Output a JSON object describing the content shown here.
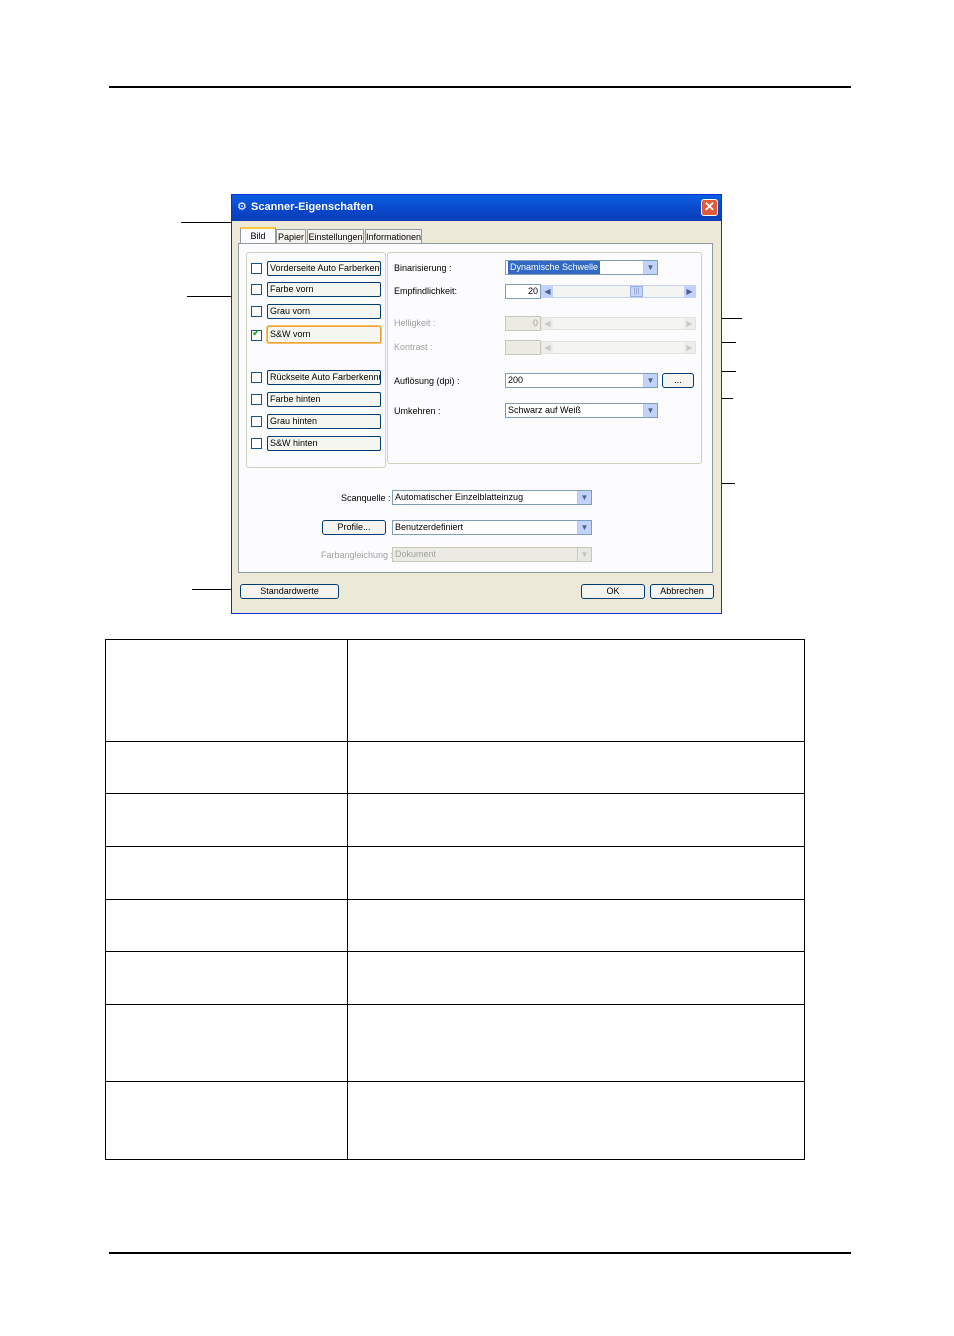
{
  "dialog": {
    "title": "Scanner-Eigenschaften",
    "tabs": [
      "Bild",
      "Papier",
      "Einstellungen",
      "Informationen"
    ],
    "front_items": [
      {
        "label": "Vorderseite Auto Farberkennu",
        "checked": false
      },
      {
        "label": "Farbe vorn",
        "checked": false
      },
      {
        "label": "Grau vorn",
        "checked": false
      },
      {
        "label": "S&W vorn",
        "checked": true
      }
    ],
    "back_items": [
      {
        "label": "Rückseite Auto Farberkennur",
        "checked": false
      },
      {
        "label": "Farbe hinten",
        "checked": false
      },
      {
        "label": "Grau hinten",
        "checked": false
      },
      {
        "label": "S&W hinten",
        "checked": false
      }
    ],
    "binarisierung": {
      "label": "Binarisierung :",
      "value": "Dynamische Schwelle"
    },
    "empfindlichkeit": {
      "label": "Empfindlichkeit:",
      "value": "20"
    },
    "helligkeit": {
      "label": "Helligkeit :",
      "value": "0"
    },
    "kontrast": {
      "label": "Kontrast :",
      "value": ""
    },
    "aufloesung": {
      "label": "Auflösung (dpi) :",
      "value": "200",
      "more_button": "..."
    },
    "umkehren": {
      "label": "Umkehren :",
      "value": "Schwarz auf Weiß"
    },
    "scanquelle": {
      "label": "Scanquelle :",
      "value": "Automatischer Einzelblatteinzug"
    },
    "profile": {
      "button": "Profile...",
      "value": "Benutzerdefiniert"
    },
    "farbangleichung": {
      "label": "Farbangleichung :",
      "value": "Dokument"
    },
    "buttons": {
      "default": "Standardwerte",
      "ok": "OK",
      "cancel": "Abbrechen"
    }
  },
  "table": {
    "rows": [
      [
        "",
        ""
      ],
      [
        "",
        ""
      ],
      [
        "",
        ""
      ],
      [
        "",
        ""
      ],
      [
        "",
        ""
      ],
      [
        "",
        ""
      ],
      [
        "",
        ""
      ],
      [
        "",
        ""
      ]
    ]
  }
}
